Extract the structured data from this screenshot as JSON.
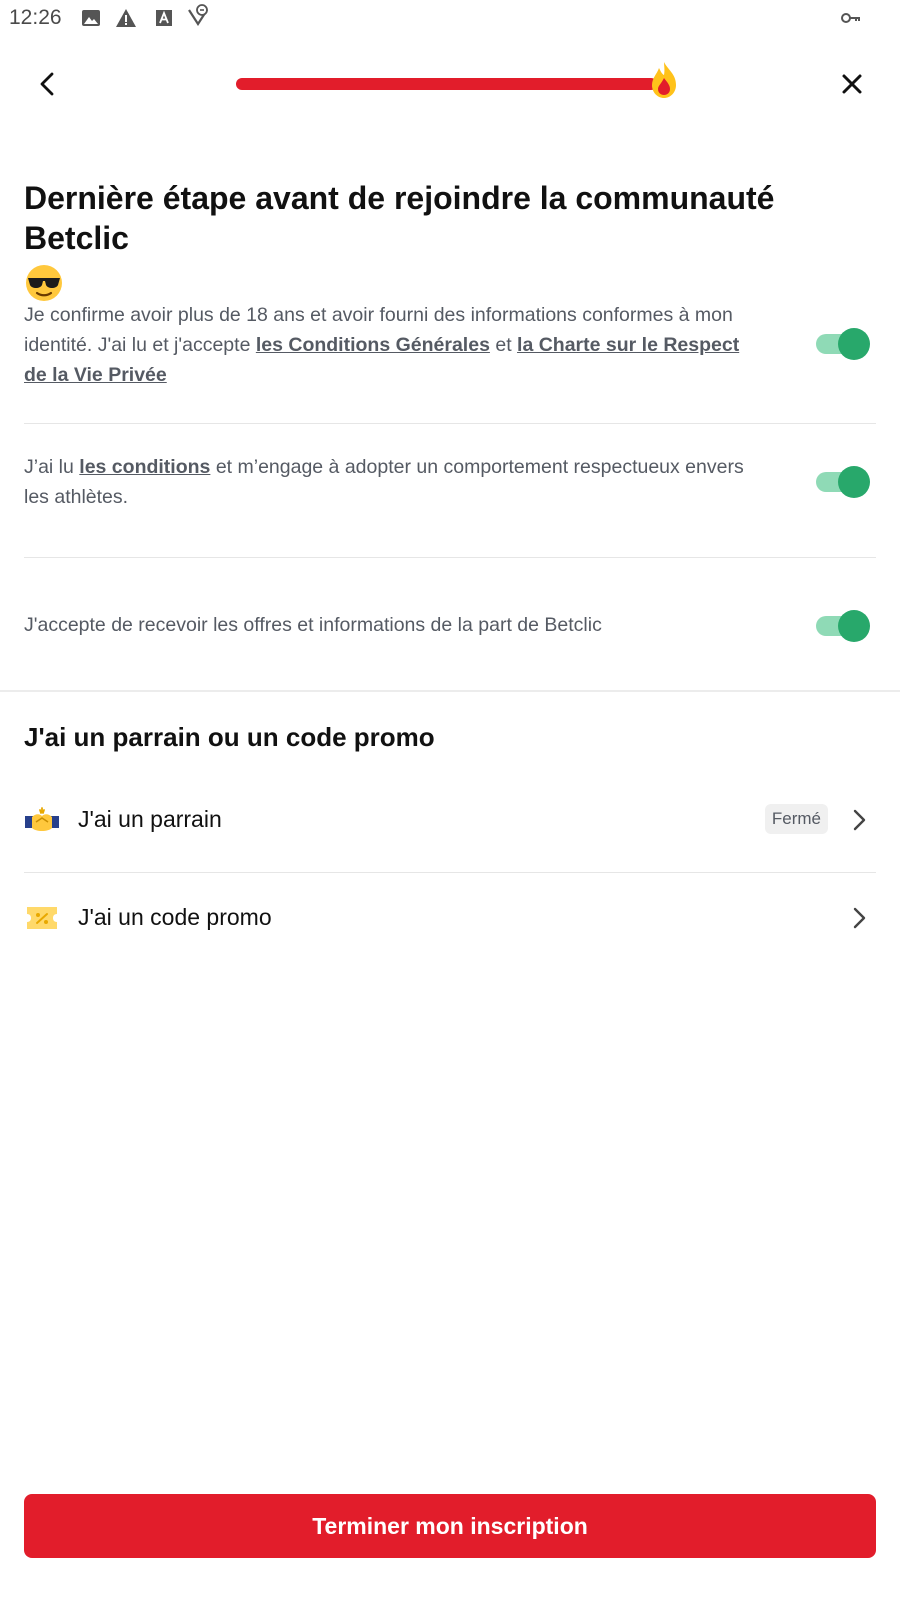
{
  "status_bar": {
    "time": "12:26",
    "icons": [
      "image-icon",
      "warning-icon",
      "text-a-icon",
      "vpn-signal-icon",
      "key-icon"
    ]
  },
  "nav": {
    "back_icon": "chevron-left-icon",
    "close_icon": "close-icon",
    "progress_fraction": 0.98,
    "progress_color": "#e21d2b",
    "progress_marker_icon": "flame-icon"
  },
  "title": {
    "text": "Dernière étape avant de rejoindre la communauté Betclic",
    "emoji_icon": "sunglasses-emoji-icon"
  },
  "consents": [
    {
      "text_before": "Je confirme avoir plus de 18 ans et avoir fourni des informations conformes à mon identité. J'ai lu et j'accepte",
      "link1": "les Conditions Générales",
      "text_middle": "et",
      "link2": "la Charte sur le Respect de la Vie Privée",
      "checked": true
    },
    {
      "text_before": "J’ai lu",
      "link1": "les conditions",
      "text_after": "et m’engage à adopter un comportement respectueux envers les athlètes.",
      "checked": true
    },
    {
      "text": "J'accepte de recevoir les offres et informations de la part de Betclic",
      "checked": true
    }
  ],
  "toggle_colors": {
    "track": "#8fdab6",
    "thumb": "#28a86b"
  },
  "referral_section": {
    "title": "J'ai un parrain ou un code promo",
    "options": [
      {
        "label": "J'ai un parrain",
        "icon": "handshake-icon",
        "badge": "Fermé"
      },
      {
        "label": "J'ai un code promo",
        "icon": "ticket-percent-icon"
      }
    ]
  },
  "cta": {
    "label": "Terminer mon inscription",
    "color": "#e21d2b"
  }
}
